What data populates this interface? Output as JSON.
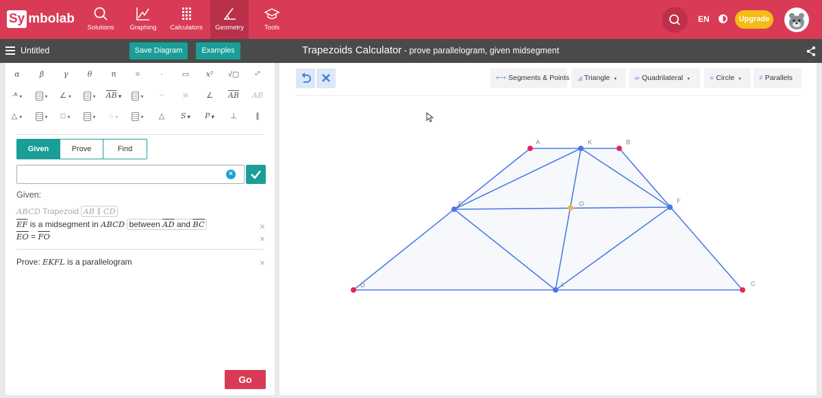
{
  "brand": {
    "logo_box": "Sy",
    "logo_rest": "mbolab"
  },
  "nav": [
    {
      "label": "Solutions",
      "icon": "search-icon"
    },
    {
      "label": "Graphing",
      "icon": "graph-icon"
    },
    {
      "label": "Calculators",
      "icon": "calculator-icon"
    },
    {
      "label": "Geometry",
      "icon": "angle-icon",
      "active": true
    },
    {
      "label": "Tools",
      "icon": "graduation-cap-icon"
    }
  ],
  "header": {
    "language": "EN",
    "upgrade_label": "Upgrade"
  },
  "subbar": {
    "doc_title": "Untitled",
    "save_label": "Save Diagram",
    "examples_label": "Examples",
    "calc_title": "Trapezoids Calculator",
    "calc_subtitle": " - prove parallelogram, given midsegment"
  },
  "keyboard": {
    "row1": [
      "α",
      "β",
      "γ",
      "θ",
      "π",
      "=",
      "·",
      "▭",
      "x²",
      "√▢",
      "▫°"
    ],
    "row2_overline": "AB",
    "row2_arc": "AB"
  },
  "tabs": [
    "Given",
    "Prove",
    "Find"
  ],
  "input": {
    "value": ""
  },
  "given": {
    "label": "Given:",
    "s1_name": "ABCD",
    "s1_type": " Trapezoid ",
    "s1_cond": "AB ∥ CD",
    "s2_seg": "EF",
    "s2_mid": " is a midsegment in ",
    "s2_quad": "ABCD",
    "s2_between": " between ",
    "s2_a": "AD",
    "s2_and": " and ",
    "s2_b": "BC",
    "s3_left": "EO",
    "s3_eq": " = ",
    "s3_right": "FO"
  },
  "prove": {
    "label": "Prove: ",
    "shape": "EKFL",
    "rest": " is a parallelogram"
  },
  "go_label": "Go",
  "tools": {
    "segments_label": "Segments & Points",
    "triangle_label": "Triangle",
    "quadrilateral_label": "Quadrilateral",
    "circle_label": "Circle",
    "parallels_label": "Parallels"
  },
  "diagram": {
    "points": [
      {
        "name": "A",
        "color": "#e8245a"
      },
      {
        "name": "K",
        "color": "#4a79e6"
      },
      {
        "name": "B",
        "color": "#e8245a"
      },
      {
        "name": "E",
        "color": "#4a79e6"
      },
      {
        "name": "O",
        "color": "#f3b545"
      },
      {
        "name": "F",
        "color": "#4a79e6"
      },
      {
        "name": "D",
        "color": "#e8245a"
      },
      {
        "name": "L",
        "color": "#4a79e6"
      },
      {
        "name": "C",
        "color": "#e8245a"
      }
    ],
    "line_color": "#4a79e6",
    "fill_color": "#f6f8fc"
  }
}
